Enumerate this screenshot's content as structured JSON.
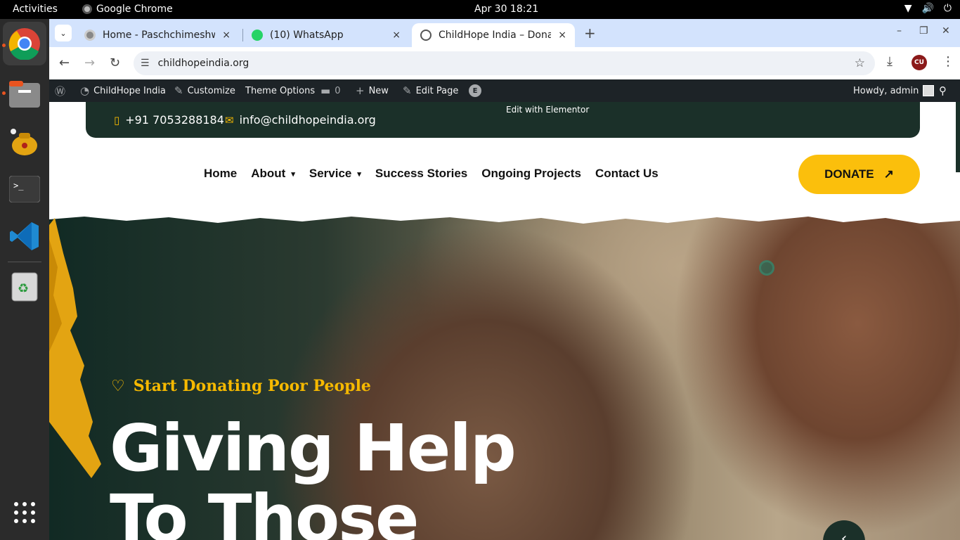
{
  "system": {
    "activities": "Activities",
    "app_name": "Google Chrome",
    "clock": "Apr 30  18:21"
  },
  "tabs": [
    {
      "title": "Home - Paschchimeshwa",
      "close": "×"
    },
    {
      "title": "(10) WhatsApp",
      "close": "×"
    },
    {
      "title": "ChildHope India – Donat",
      "close": "×",
      "active": true
    }
  ],
  "tab_controls": {
    "new_tab": "+",
    "minimize": "–",
    "restore": "❐",
    "close": "✕"
  },
  "toolbar": {
    "back": "←",
    "forward": "→",
    "reload": "↻",
    "url": "childhopeindia.org",
    "profile": "CU"
  },
  "wp_admin": {
    "site_name": "ChildHope India",
    "customize": "Customize",
    "theme_options": "Theme Options",
    "comments_count": "0",
    "new": "New",
    "edit_page": "Edit Page",
    "greeting": "Howdy, admin",
    "elementor_tip": "Edit with Elementor"
  },
  "contact": {
    "phone": "+91 7053288184",
    "email": "info@childhopeindia.org"
  },
  "nav": {
    "items": [
      "Home",
      "About",
      "Service",
      "Success Stories",
      "Ongoing Projects",
      "Contact Us"
    ],
    "donate": "DONATE"
  },
  "hero": {
    "kicker": "Start Donating Poor People",
    "title_line1": "Giving Help",
    "title_line2": "To Those"
  },
  "colors": {
    "brand_dark": "#1b3029",
    "brand_yellow": "#fbbf0c",
    "wp_bar": "#1d2327",
    "tabstrip": "#d3e3fd"
  }
}
